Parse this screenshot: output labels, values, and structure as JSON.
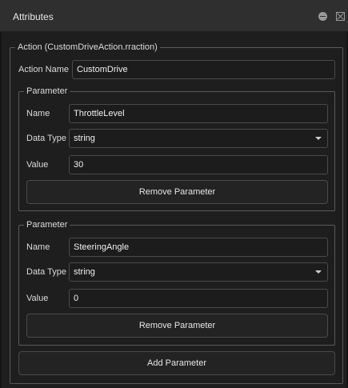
{
  "window": {
    "title": "Attributes",
    "icons": [
      "minimize-icon",
      "close-icon"
    ]
  },
  "action": {
    "group_title": "Action (CustomDriveAction.rraction)",
    "name_label": "Action Name",
    "name_value": "CustomDrive"
  },
  "parameters": [
    {
      "group_title": "Parameter",
      "name_label": "Name",
      "name_value": "ThrottleLevel",
      "type_label": "Data Type",
      "type_value": "string",
      "value_label": "Value",
      "value_value": "30",
      "remove_label": "Remove Parameter"
    },
    {
      "group_title": "Parameter",
      "name_label": "Name",
      "name_value": "SteeringAngle",
      "type_label": "Data Type",
      "type_value": "string",
      "value_label": "Value",
      "value_value": "0",
      "remove_label": "Remove Parameter"
    }
  ],
  "add_parameter_label": "Add Parameter"
}
